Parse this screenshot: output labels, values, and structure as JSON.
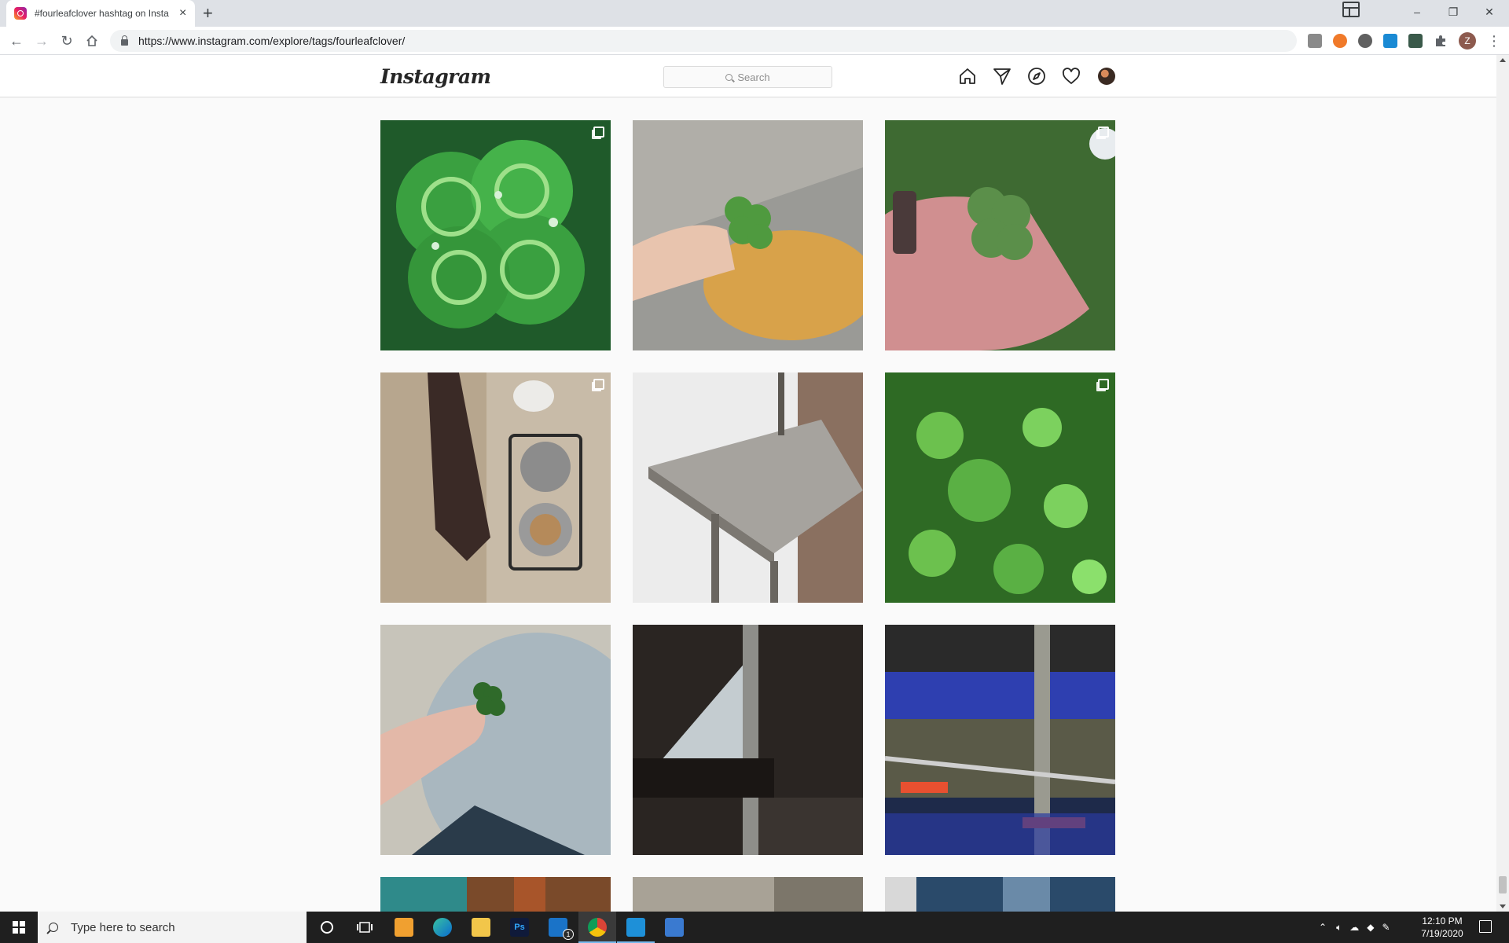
{
  "browser": {
    "tab_title": "#fourleafclover hashtag on Insta",
    "tab_close": "×",
    "new_tab": "+",
    "url": "https://www.instagram.com/explore/tags/fourleafclover/",
    "profile_initial": "Z",
    "menu": "⋮",
    "back": "←",
    "forward": "→",
    "reload": "↻",
    "minimize": "–",
    "restore": "❐",
    "close": "✕"
  },
  "instagram": {
    "logo": "Instagram",
    "search_placeholder": "Search",
    "nav_icons": [
      "home-icon",
      "direct-message-icon",
      "explore-compass-icon",
      "activity-heart-icon",
      "profile-avatar"
    ]
  },
  "posts": [
    {
      "subject": "four-leaf clover with water drops",
      "multi": true,
      "colors": [
        "#2f8f2e",
        "#5fc451"
      ]
    },
    {
      "subject": "hand holding clover over lichen",
      "multi": false,
      "colors": [
        "#9a9a96",
        "#d8a24a"
      ]
    },
    {
      "subject": "clover in palm",
      "multi": true,
      "colors": [
        "#c98a8a",
        "#4f7f3f"
      ]
    },
    {
      "subject": "cat paw shadow and bowls",
      "multi": true,
      "colors": [
        "#c8b8a4",
        "#6b5d52"
      ]
    },
    {
      "subject": "grey table corner",
      "multi": false,
      "colors": [
        "#e9e9e9",
        "#8c8882"
      ]
    },
    {
      "subject": "clovers in grass",
      "multi": true,
      "colors": [
        "#3e8e2c",
        "#8cd16a"
      ]
    },
    {
      "subject": "fingers holding tiny clover",
      "multi": false,
      "colors": [
        "#a9b7bf",
        "#e3b8a8"
      ]
    },
    {
      "subject": "dark window frame",
      "multi": false,
      "colors": [
        "#2a2522",
        "#c4ccd0"
      ]
    },
    {
      "subject": "subway station railing",
      "multi": false,
      "colors": [
        "#1e2a4a",
        "#6b6a5a"
      ]
    },
    {
      "subject": "rusty teal wall",
      "multi": false,
      "colors": [
        "#2f8a8a",
        "#8a4a2a"
      ]
    },
    {
      "subject": "concrete texture",
      "multi": false,
      "colors": [
        "#9c968c",
        "#c4beb4"
      ]
    },
    {
      "subject": "building facade",
      "multi": false,
      "colors": [
        "#2a4a6a",
        "#9ab0c4"
      ]
    }
  ],
  "taskbar": {
    "search_placeholder": "Type here to search",
    "time": "12:10 PM",
    "date": "7/19/2020",
    "mail_badge": "1",
    "ps_label": "Ps"
  }
}
